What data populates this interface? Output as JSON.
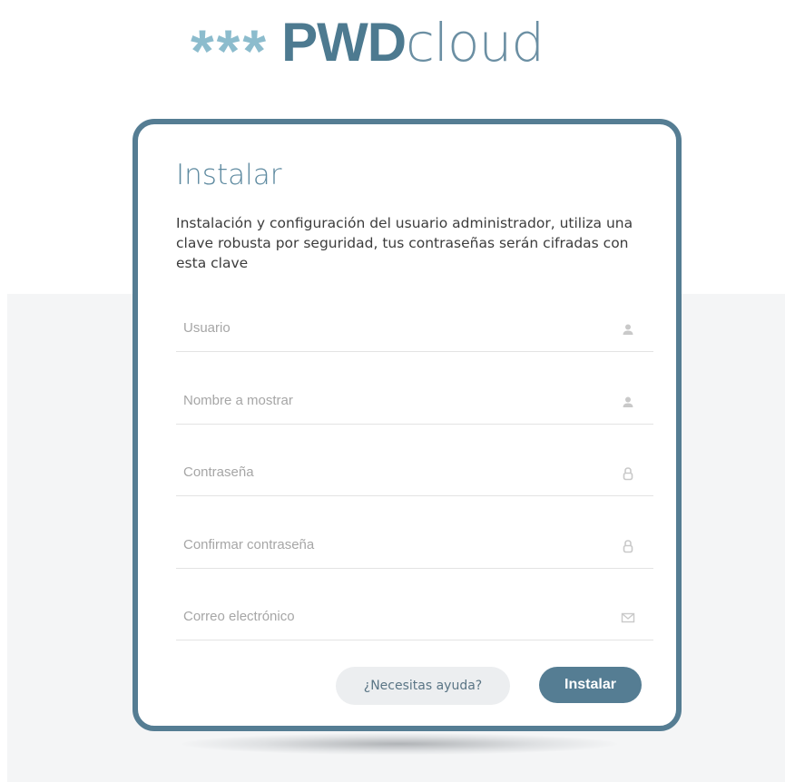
{
  "logo": {
    "stars": "***",
    "pwd": "PWD",
    "cloud": "cloud"
  },
  "card": {
    "title": "Instalar",
    "description": "Instalación y configuración del usuario administrador, utiliza una clave robusta por seguridad, tus contraseñas serán cifradas con esta clave"
  },
  "fields": {
    "username": {
      "placeholder": "Usuario",
      "value": "",
      "icon": "user-icon"
    },
    "display_name": {
      "placeholder": "Nombre a mostrar",
      "value": "",
      "icon": "user-icon"
    },
    "password": {
      "placeholder": "Contraseña",
      "value": "",
      "icon": "lock-icon"
    },
    "confirm_password": {
      "placeholder": "Confirmar contraseña",
      "value": "",
      "icon": "lock-icon"
    },
    "email": {
      "placeholder": "Correo electrónico",
      "value": "",
      "icon": "envelope-icon"
    }
  },
  "buttons": {
    "help_label": "¿Necesitas ayuda?",
    "install_label": "Instalar"
  },
  "colors": {
    "accent": "#557d93",
    "logo_stars": "#8cbccd",
    "title": "#5e8aa0"
  }
}
